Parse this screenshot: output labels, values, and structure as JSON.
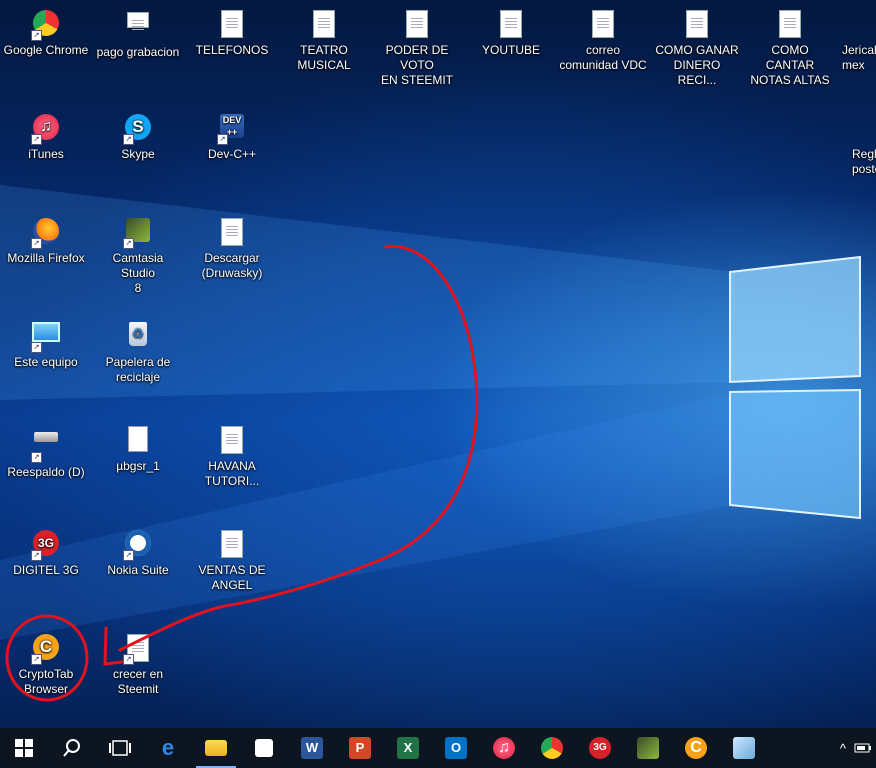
{
  "desktop": {
    "icons": [
      {
        "label": "Google Chrome",
        "icon": "chrome-icon"
      },
      {
        "label": "pago grabacion",
        "icon": "document-icon"
      },
      {
        "label": "TELEFONOS",
        "icon": "document-icon"
      },
      {
        "label": "TEATRO\nMUSICAL",
        "icon": "document-icon"
      },
      {
        "label": "PODER DE VOTO\nEN STEEMIT",
        "icon": "document-icon"
      },
      {
        "label": "YOUTUBE",
        "icon": "document-icon"
      },
      {
        "label": "correo\ncomunidad VDC",
        "icon": "document-icon"
      },
      {
        "label": "COMO GANAR\nDINERO RECI...",
        "icon": "document-icon"
      },
      {
        "label": "COMO CANTAR\nNOTAS ALTAS",
        "icon": "document-icon"
      },
      {
        "label": "Jericalla\nmex",
        "icon": "document-icon"
      },
      {
        "label": "iTunes",
        "icon": "itunes-icon"
      },
      {
        "label": "Skype",
        "icon": "skype-icon"
      },
      {
        "label": "Dev-C++",
        "icon": "devcpp-icon"
      },
      {
        "label": "Regla\nposteo",
        "icon": "document-icon"
      },
      {
        "label": "Mozilla Firefox",
        "icon": "firefox-icon"
      },
      {
        "label": "Camtasia Studio\n8",
        "icon": "camtasia-icon"
      },
      {
        "label": "Descargar\n(Druwasky)",
        "icon": "document-icon"
      },
      {
        "label": "Este equipo",
        "icon": "computer-icon"
      },
      {
        "label": "Papelera de\nreciclaje",
        "icon": "recycle-bin-icon"
      },
      {
        "label": "Reespaldo (D)",
        "icon": "drive-icon"
      },
      {
        "label": "µbgsr_1",
        "icon": "blank-file-icon"
      },
      {
        "label": "HAVANA\nTUTORI...",
        "icon": "document-icon"
      },
      {
        "label": "DIGITEL 3G",
        "icon": "digitel-3g-icon"
      },
      {
        "label": "Nokia Suite",
        "icon": "nokia-suite-icon"
      },
      {
        "label": "VENTAS DE\nANGEL",
        "icon": "document-icon"
      },
      {
        "label": "CryptoTab\nBrowser",
        "icon": "cryptotab-icon"
      },
      {
        "label": "crecer en\nSteemit",
        "icon": "document-icon"
      }
    ]
  },
  "taskbar": {
    "items": [
      {
        "icon": "windows-start-icon"
      },
      {
        "icon": "search-icon"
      },
      {
        "icon": "task-view-icon"
      },
      {
        "icon": "edge-icon"
      },
      {
        "icon": "file-explorer-icon"
      },
      {
        "icon": "store-icon"
      },
      {
        "icon": "word-icon"
      },
      {
        "icon": "powerpoint-icon"
      },
      {
        "icon": "excel-icon"
      },
      {
        "icon": "outlook-icon"
      },
      {
        "icon": "itunes-icon"
      },
      {
        "icon": "chrome-icon"
      },
      {
        "icon": "digitel-3g-icon"
      },
      {
        "icon": "camtasia-icon"
      },
      {
        "icon": "cryptotab-icon"
      },
      {
        "icon": "notepad-icon"
      }
    ],
    "tray": {
      "chevron": "^"
    }
  },
  "colors": {
    "annotation": "#e0141e",
    "accent": "#7fb2ff"
  }
}
